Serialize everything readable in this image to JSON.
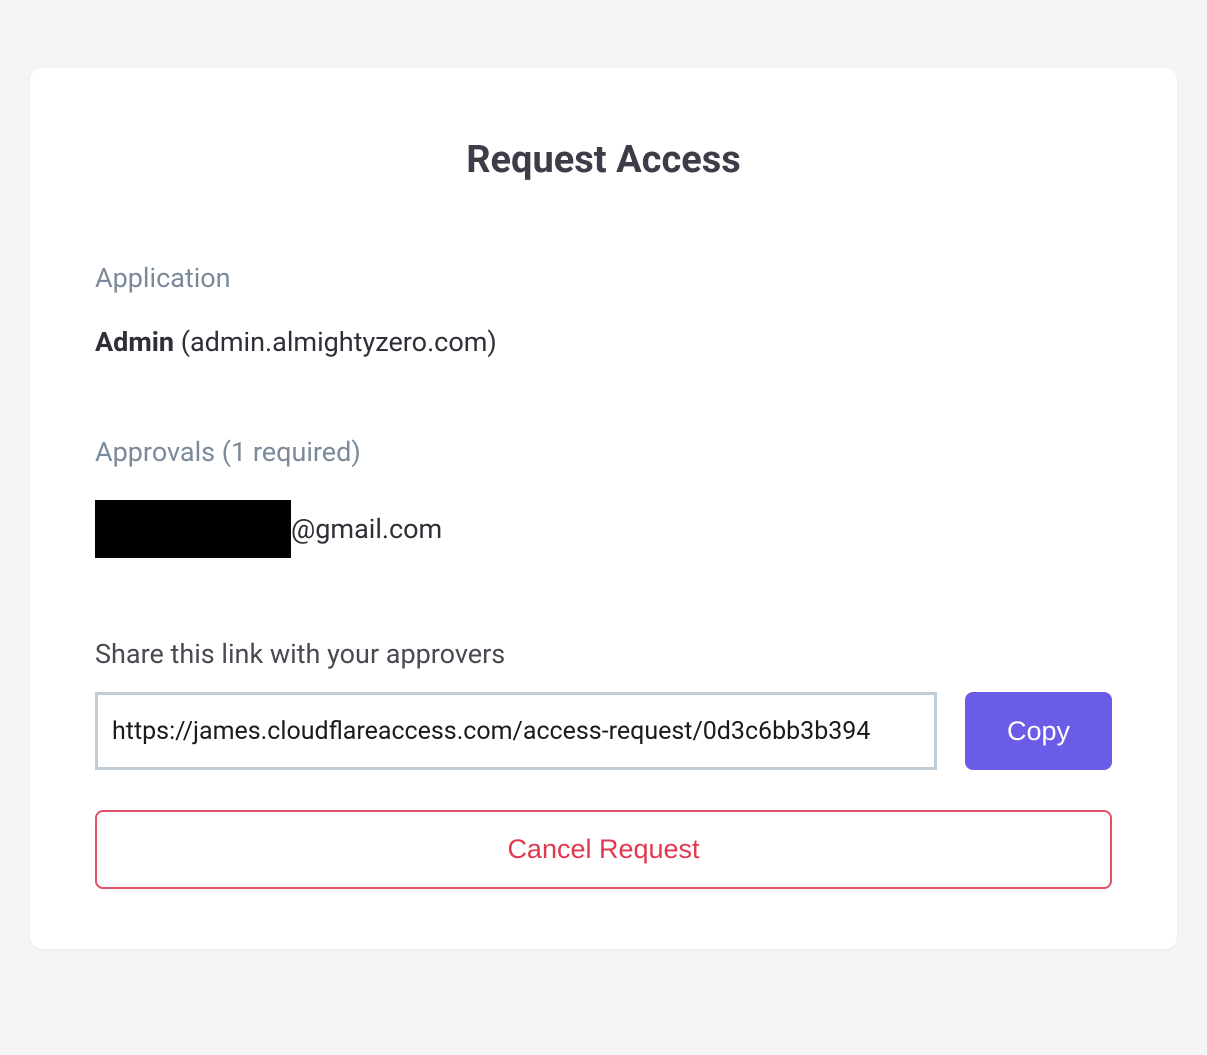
{
  "title": "Request Access",
  "application": {
    "label": "Application",
    "name": "Admin",
    "domain": "(admin.almightyzero.com)"
  },
  "approvals": {
    "label": "Approvals (1 required)",
    "approver_email_suffix": "@gmail.com"
  },
  "share": {
    "label": "Share this link with your approvers",
    "url": "https://james.cloudflareaccess.com/access-request/0d3c6bb3b394",
    "copy_label": "Copy"
  },
  "cancel_label": "Cancel Request"
}
